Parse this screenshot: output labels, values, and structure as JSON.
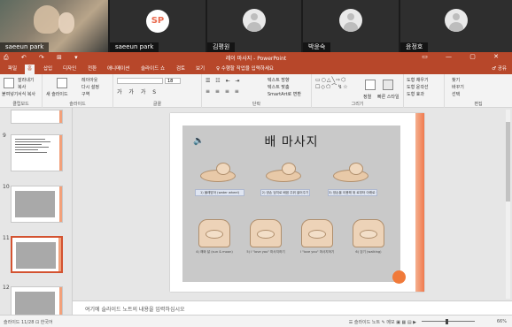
{
  "participants": [
    {
      "name": "saeeun park",
      "kind": "camera"
    },
    {
      "name": "saeeun park",
      "kind": "initials",
      "initials": "SP"
    },
    {
      "name": "김평원",
      "kind": "avatar"
    },
    {
      "name": "박윤숙",
      "kind": "avatar"
    },
    {
      "name": "윤정호",
      "kind": "avatar"
    }
  ],
  "titlebar": {
    "title": "레이 마사지 - PowerPoint",
    "qat": "⎙ ↶ ↷ ⊞ ▾",
    "window_buttons": "▭ — ▢ ✕"
  },
  "tabs": [
    "파일",
    "홈",
    "삽입",
    "디자인",
    "전환",
    "애니메이션",
    "슬라이드 쇼",
    "검토",
    "보기"
  ],
  "tell_me": "♀ 수행할 작업을 입력하세요",
  "tabs_right": "♂ 공유",
  "ribbon": {
    "groups": [
      "클립보드",
      "슬라이드",
      "글꼴",
      "단락",
      "그리기",
      "편집"
    ],
    "buttons": {
      "paste": "붙여넣기",
      "cut": "잘라내기",
      "copy": "복사",
      "format_painter": "서식 복사",
      "new_slide": "새 슬라이드",
      "layout": "레이아웃",
      "reset": "다시 설정",
      "section": "구역",
      "font_size": "18",
      "text_direction": "텍스트 방향",
      "align_text": "텍스트 맞춤",
      "smartart": "SmartArt로 변환",
      "arrange": "정렬",
      "quick_styles": "빠른 스타일",
      "shape_fill": "도형 채우기",
      "shape_outline": "도형 윤곽선",
      "shape_effects": "도형 효과",
      "find": "찾기",
      "replace": "바꾸기",
      "select": "선택"
    }
  },
  "thumbnails": [
    {
      "num": "9",
      "kind": "text"
    },
    {
      "num": "10",
      "kind": "image"
    },
    {
      "num": "11",
      "kind": "image",
      "selected": true
    },
    {
      "num": "12",
      "kind": "image"
    }
  ],
  "slide": {
    "title": "배 마사지",
    "top_captions": [
      "1) 물레방아\n(water wheel)",
      "2) 양손 엄지로 배꼽 주위 쓸어주기",
      "3) 양손을 이용해 위 로부터 아래로 쓸어주기"
    ],
    "bottom_captions": [
      "4) 해와 달\n(sun & moon)",
      "5) I \"love you\" 마사지하기",
      "I \"love you\" 마사지하기",
      "6) 걷기\n(walking)"
    ]
  },
  "notes_placeholder": "여기에 슬라이드 노트의 내용을 입력하십시오",
  "status": {
    "left": "슬라이드 11/28  ⊡  한국어",
    "right": "☰ 슬라이드 노트  ✎ 메모  ▣  ▦  ▤  ▶",
    "zoom": "66%"
  }
}
